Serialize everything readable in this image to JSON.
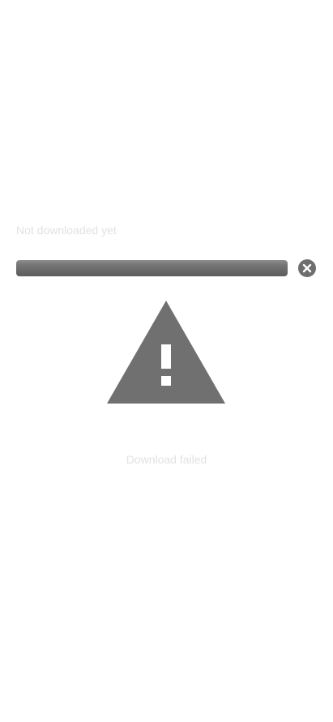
{
  "download": {
    "status_label": "Not downloaded yet",
    "progress": 0,
    "failed_label": "Download failed"
  },
  "icons": {
    "cancel": "close-icon",
    "warning": "warning-icon"
  },
  "colors": {
    "bar": "#6e6e6e",
    "icon": "#707070",
    "muted_text": "#e2e2e2",
    "background": "#ffffff"
  }
}
